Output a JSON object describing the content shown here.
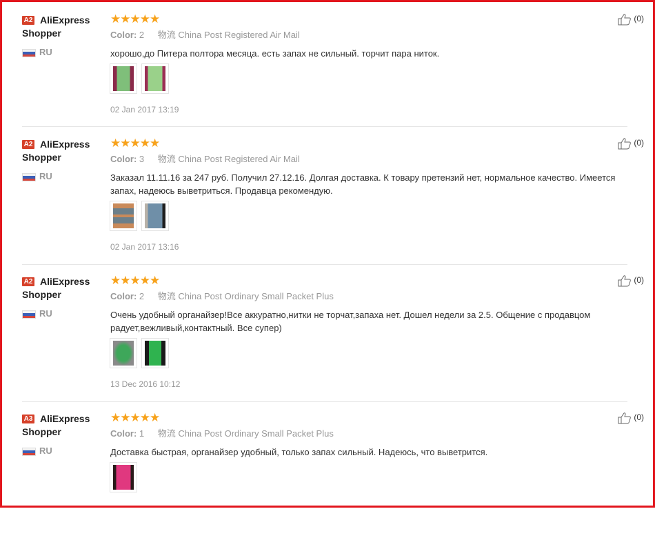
{
  "reviews": [
    {
      "badge": "A2",
      "name": "AliExpress Shopper",
      "country": "RU",
      "stars": "★★★★★",
      "color_label": "Color:",
      "color_value": "2",
      "shipping_label": "物流",
      "shipping_value": "China Post Registered Air Mail",
      "text": "хорошо,до Питера полтора месяца. есть запах не сильный. торчит пара ниток.",
      "date": "02 Jan 2017 13:19",
      "likes": "(0)",
      "photos": [
        {
          "icon": "photo-thumbnail-icon",
          "color": "#7fbf7a",
          "bg": "#8a2a4a"
        },
        {
          "icon": "photo-thumbnail-icon",
          "color": "#9ad18a",
          "bg": "#9a2f55"
        }
      ]
    },
    {
      "badge": "A2",
      "name": "AliExpress Shopper",
      "country": "RU",
      "stars": "★★★★★",
      "color_label": "Color:",
      "color_value": "3",
      "shipping_label": "物流",
      "shipping_value": "China Post Registered Air Mail",
      "text": "Заказал 11.11.16 за 247 руб. Получил 27.12.16. Долгая доставка. К товару претензий нет, нормальное качество. Имеется запах, надеюсь выветриться. Продавца рекомендую.",
      "date": "02 Jan 2017 13:16",
      "likes": "(0)",
      "photos": [
        {
          "icon": "photo-thumbnail-icon",
          "color": "#6b7f8a",
          "bg": "#c98a5a"
        },
        {
          "icon": "photo-thumbnail-icon",
          "color": "#6f8fa8",
          "bg": "#b8b2a8"
        }
      ]
    },
    {
      "badge": "A2",
      "name": "AliExpress Shopper",
      "country": "RU",
      "stars": "★★★★★",
      "color_label": "Color:",
      "color_value": "2",
      "shipping_label": "物流",
      "shipping_value": "China Post Ordinary Small Packet Plus",
      "text": "Очень удобный органайзер!Все аккуратно,нитки не торчат,запаха нет. Дошел недели за 2.5. Общение с продавцом радует,вежливый,контактный. Все супер)",
      "date": "13 Dec 2016 10:12",
      "likes": "(0)",
      "photos": [
        {
          "icon": "photo-thumbnail-icon",
          "color": "#3ea75a",
          "bg": "#8a8a8a"
        },
        {
          "icon": "photo-thumbnail-icon",
          "color": "#2fb34f",
          "bg": "#1a1a1a"
        }
      ]
    },
    {
      "badge": "A3",
      "name": "AliExpress Shopper",
      "country": "RU",
      "stars": "★★★★★",
      "color_label": "Color:",
      "color_value": "1",
      "shipping_label": "物流",
      "shipping_value": "China Post Ordinary Small Packet Plus",
      "text": "Доставка быстрая, органайзер удобный, только запах сильный. Надеюсь, что выветрится.",
      "date": "",
      "likes": "(0)",
      "photos": [
        {
          "icon": "photo-thumbnail-icon",
          "color": "#e0387f",
          "bg": "#2a1a1a"
        }
      ]
    }
  ]
}
